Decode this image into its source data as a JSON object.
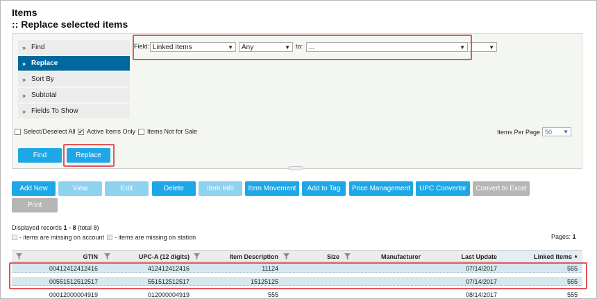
{
  "page": {
    "title": "Items",
    "subtitle": ":: Replace selected items"
  },
  "sidebar": {
    "items": [
      {
        "label": "Find",
        "active": false
      },
      {
        "label": "Replace",
        "active": true
      },
      {
        "label": "Sort By",
        "active": false
      },
      {
        "label": "Subtotal",
        "active": false
      },
      {
        "label": "Fields To Show",
        "active": false
      }
    ]
  },
  "replace_form": {
    "field_label": "Field:",
    "field_value": "Linked Items",
    "condition_value": "Any",
    "to_label": "to:",
    "to_value": "..."
  },
  "filters": {
    "select_all": {
      "label": "Select/Deselect All",
      "checked": false
    },
    "active_only": {
      "label": "Active Items Only",
      "checked": true
    },
    "not_for_sale": {
      "label": "Items Not for Sale",
      "checked": false
    },
    "items_per_page_label": "Items Per Page",
    "items_per_page_value": "50"
  },
  "form_buttons": {
    "find": "Find",
    "replace": "Replace"
  },
  "toolbar": {
    "add_new": "Add New",
    "view": "View",
    "edit": "Edit",
    "delete": "Delete",
    "item_info": "Item Info",
    "item_movement": "Item Movement",
    "add_to_tag": "Add to Tag",
    "price_management": "Price Management",
    "upc_convertor": "UPC Convertor",
    "convert_to_excel": "Convert to Excel",
    "print": "Print"
  },
  "records": {
    "prefix": "Displayed records ",
    "range": "1 - 8",
    "suffix": " (total 8)",
    "legend_account": " - items are missing on account",
    "legend_station": " - items are missing on station",
    "pages_label": "Pages: ",
    "pages_value": "1"
  },
  "table": {
    "columns": [
      "GTIN",
      "UPC-A (12 digits)",
      "Item Description",
      "Size",
      "Manufacturer",
      "Last Update",
      "Linked Items"
    ],
    "sorted_column": "Linked Items",
    "rows": [
      {
        "gtin": "00412412412416",
        "upca": "412412412416",
        "desc": "11124",
        "size": "",
        "manufacturer": "",
        "last_update": "07/14/2017",
        "linked": "555",
        "selected": true
      },
      {
        "gtin": "00551512512517",
        "upca": "551512512517",
        "desc": "15125125",
        "size": "",
        "manufacturer": "",
        "last_update": "07/14/2017",
        "linked": "555",
        "selected": true
      },
      {
        "gtin": "00012000004919",
        "upca": "012000004919",
        "desc": "555",
        "size": "",
        "manufacturer": "",
        "last_update": "08/14/2017",
        "linked": "555",
        "selected": false
      }
    ]
  },
  "colors": {
    "accent_blue": "#1ea7e6",
    "sidebar_active": "#00689d",
    "highlight_red": "#e0565b",
    "selected_row": "#d6e8ef"
  }
}
